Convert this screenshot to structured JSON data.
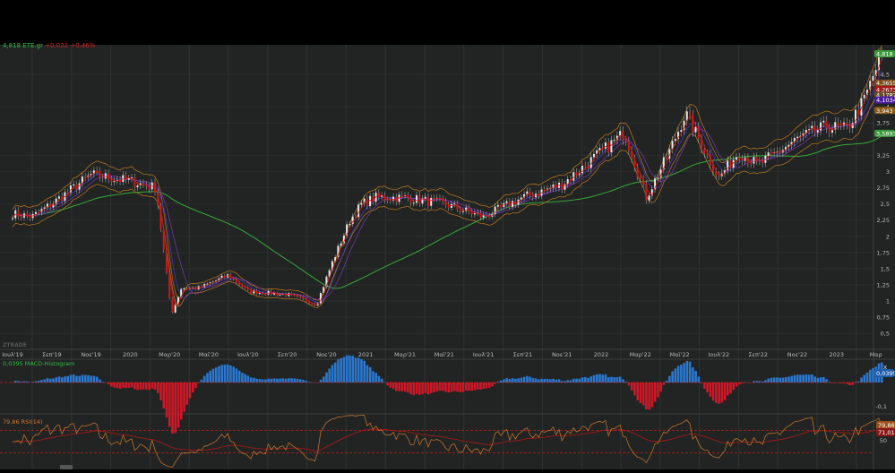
{
  "header": {
    "price": "4,818",
    "symbol": "ETE.gr",
    "change": "+0,022",
    "change_pct": "+0,46%"
  },
  "watermark": "ZTRADE",
  "chart_data": {
    "type": "line",
    "title": "ETE.gr candlestick",
    "price_axis_ticks": [
      "4,5",
      "4",
      "3,75",
      "3,25",
      "3",
      "2,75",
      "2,5",
      "2,25",
      "2",
      "1,75",
      "1,5",
      "1,25",
      "1",
      "0,75",
      "0,5"
    ],
    "price_axis_values": [
      4.5,
      4,
      3.75,
      3.25,
      3,
      2.75,
      2.5,
      2.25,
      2,
      1.75,
      1.5,
      1.25,
      1,
      0.75,
      0.5
    ],
    "ylim": [
      0.4,
      4.9
    ],
    "x_labels": [
      "Ιουλ'19",
      "Σεπ'19",
      "Νοε'19",
      "2020",
      "Μαρ'20",
      "Μαϊ'20",
      "Ιουλ'20",
      "Σεπ'20",
      "Νοε'20",
      "2021",
      "Μαρ'21",
      "Μαϊ'21",
      "Ιουλ'21",
      "Σεπ'21",
      "Νοε'21",
      "2022",
      "Μαρ'22",
      "Μαϊ'22",
      "Ιουλ'22",
      "Σεπ'22",
      "Νοε'22",
      "2023",
      "Μαρ"
    ],
    "x_label_months": [
      0,
      2,
      4,
      6,
      8,
      10,
      12,
      14,
      16,
      18,
      20,
      22,
      24,
      26,
      28,
      30,
      32,
      34,
      36,
      38,
      40,
      42,
      44
    ],
    "price_keypoints_month": [
      0,
      1,
      2,
      4,
      6,
      7.3,
      8.1,
      8.6,
      9.5,
      11,
      12,
      14,
      15.5,
      16.3,
      17.2,
      17.8,
      18.5,
      20,
      22,
      24,
      26,
      28,
      30,
      31.2,
      32.3,
      33.4,
      34.3,
      36,
      37,
      38,
      40,
      41.5,
      42.5,
      43.4,
      44.3
    ],
    "price_keypoints_value": [
      2.35,
      2.3,
      2.5,
      2.95,
      2.85,
      2.75,
      0.8,
      1.2,
      1.2,
      1.4,
      1.15,
      1.1,
      0.95,
      1.6,
      2.25,
      2.5,
      2.6,
      2.6,
      2.5,
      2.3,
      2.6,
      2.8,
      3.3,
      3.6,
      2.6,
      3.25,
      3.9,
      2.9,
      3.3,
      3.1,
      3.5,
      3.7,
      3.65,
      4.1,
      4.818
    ],
    "price_labels": [
      {
        "text": "4,818",
        "color": "#3a9a3a"
      },
      {
        "text": "4,3655",
        "color": "#7a4a1a"
      },
      {
        "text": "4,2673",
        "color": "#a01818"
      },
      {
        "text": "4,1787",
        "color": "#6a4a2a"
      },
      {
        "text": "4,1034",
        "color": "#4a1aa0"
      },
      {
        "text": "3,943",
        "color": "#8a5a1a"
      },
      {
        "text": "3,5893",
        "color": "#3a9a3a"
      }
    ],
    "macd": {
      "label": "0,0395 MACD-Histogram",
      "value_label": "0,0395",
      "tick": "-0,1",
      "close": "x"
    },
    "rsi": {
      "label": "79,86 RSI(14)",
      "value_label": "79,86",
      "signal_label": "71,01",
      "tick": "50",
      "close": "x"
    }
  }
}
